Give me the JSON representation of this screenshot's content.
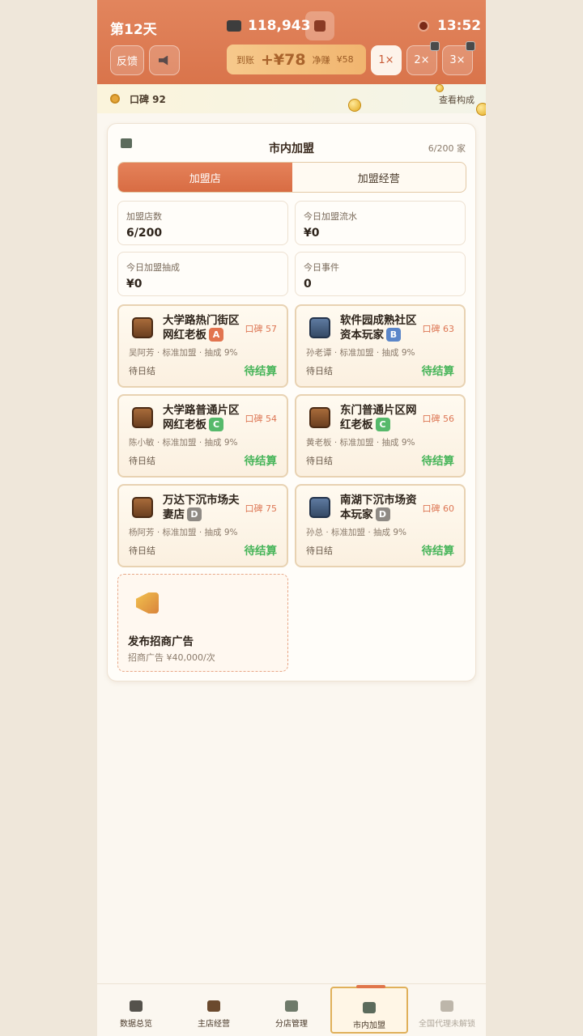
{
  "header": {
    "day": "第12天",
    "money": "118,943",
    "time": "13:52",
    "feedback_label": "反馈",
    "settlement": {
      "received_label": "到账",
      "received_value": "+¥78",
      "net_label": "净赚",
      "net_value": "¥58"
    },
    "speeds": [
      "1×",
      "2×",
      "3×"
    ],
    "active_speed": "1×"
  },
  "reputation": {
    "text": "口碑 92",
    "link": "查看构成"
  },
  "panel": {
    "title": "市内加盟",
    "count": "6/200 家",
    "tabs": [
      "加盟店",
      "加盟经营"
    ],
    "active_tab": "加盟店",
    "stats": [
      {
        "label": "加盟店数",
        "value": "6/200"
      },
      {
        "label": "今日加盟流水",
        "value": "¥0"
      },
      {
        "label": "今日加盟抽成",
        "value": "¥0"
      },
      {
        "label": "今日事件",
        "value": "0"
      }
    ],
    "stores": [
      {
        "name": "大学路热门街区网红老板",
        "grade": "A",
        "grade_color": "#e2744f",
        "rep": "口碑 57",
        "meta": "吴阿芳 · 标准加盟 · 抽成 9%",
        "status_left": "待日结",
        "status_right": "待结算"
      },
      {
        "name": "软件园成熟社区资本玩家",
        "grade": "B",
        "grade_color": "#5b86c9",
        "rep": "口碑 63",
        "meta": "孙老谭 · 标准加盟 · 抽成 9%",
        "status_left": "待日结",
        "status_right": "待结算"
      },
      {
        "name": "大学路普通片区网红老板",
        "grade": "C",
        "grade_color": "#56b96b",
        "rep": "口碑 54",
        "meta": "陈小敏 · 标准加盟 · 抽成 9%",
        "status_left": "待日结",
        "status_right": "待结算"
      },
      {
        "name": "东门普通片区网红老板",
        "grade": "C",
        "grade_color": "#56b96b",
        "rep": "口碑 56",
        "meta": "黄老板 · 标准加盟 · 抽成 9%",
        "status_left": "待日结",
        "status_right": "待结算"
      },
      {
        "name": "万达下沉市场夫妻店",
        "grade": "D",
        "grade_color": "#8f8a84",
        "rep": "口碑 75",
        "meta": "杨阿芳 · 标准加盟 · 抽成 9%",
        "status_left": "待日结",
        "status_right": "待结算"
      },
      {
        "name": "南湖下沉市场资本玩家",
        "grade": "D",
        "grade_color": "#8f8a84",
        "rep": "口碑 60",
        "meta": "孙总 · 标准加盟 · 抽成 9%",
        "status_left": "待日结",
        "status_right": "待结算"
      }
    ],
    "ad": {
      "title": "发布招商广告",
      "subtitle": "招商广告 ¥40,000/次"
    }
  },
  "nav": {
    "items": [
      "数据总览",
      "主店经营",
      "分店管理",
      "市内加盟",
      "全国代理未解锁"
    ],
    "active": "市内加盟"
  }
}
